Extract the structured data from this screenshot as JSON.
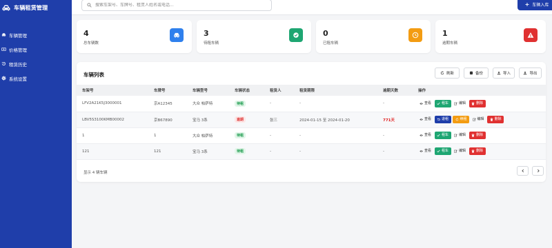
{
  "app": {
    "title": "车辆租赁管理"
  },
  "sidebar": {
    "items": [
      {
        "label": "车辆管理",
        "icon": "car-icon"
      },
      {
        "label": "价格管理",
        "icon": "money-icon"
      },
      {
        "label": "租赁历史",
        "icon": "history-icon"
      },
      {
        "label": "系统设置",
        "icon": "gear-icon"
      }
    ]
  },
  "search": {
    "placeholder": "搜索车架号、车牌号、租赁人姓名或电话..."
  },
  "header": {
    "add_button": "车辆入库"
  },
  "stats": [
    {
      "value": "4",
      "label": "总车辆数",
      "icon": "car-icon",
      "color": "#2f80ed"
    },
    {
      "value": "3",
      "label": "待租车辆",
      "icon": "check-circle-icon",
      "color": "#1ea672"
    },
    {
      "value": "0",
      "label": "已租车辆",
      "icon": "clock-icon",
      "color": "#f39c12"
    },
    {
      "value": "1",
      "label": "逾期车辆",
      "icon": "warning-icon",
      "color": "#e03131"
    }
  ],
  "table": {
    "title": "车辆列表",
    "toolbar": {
      "refresh": "刷新",
      "backup": "备份",
      "import": "导入",
      "export": "导出"
    },
    "columns": [
      "车架号",
      "车牌号",
      "车辆型号",
      "车辆状态",
      "租赁人",
      "租赁期限",
      "逾期天数",
      "操作"
    ],
    "rows": [
      {
        "vin": "LFV2A21K5J3000001",
        "plate": "京A12345",
        "model": "大众 帕萨特",
        "status": "待租",
        "renter": "-",
        "period": "-",
        "overdue": "-",
        "actions": {
          "view": "查看",
          "primary": "租车",
          "edit": "编辑",
          "delete": "删除"
        }
      },
      {
        "vin": "LBV5S3100KMB00002",
        "plate": "京B67890",
        "model": "宝马 3系",
        "status": "逾期",
        "renter": "张三",
        "period": "2024-01-15 至 2024-01-20",
        "overdue": "771天",
        "actions": {
          "view": "查看",
          "return": "退租",
          "renew": "续租",
          "edit": "编辑",
          "delete": "删除"
        }
      },
      {
        "vin": "1",
        "plate": "1",
        "model": "大众 帕萨特",
        "status": "待租",
        "renter": "-",
        "period": "-",
        "overdue": "-",
        "actions": {
          "view": "查看",
          "primary": "租车",
          "edit": "编辑",
          "delete": "删除"
        }
      },
      {
        "vin": "121",
        "plate": "121",
        "model": "宝马 3系",
        "status": "待租",
        "renter": "-",
        "period": "-",
        "overdue": "-",
        "actions": {
          "view": "查看",
          "primary": "租车",
          "edit": "编辑",
          "delete": "删除"
        }
      }
    ],
    "footer": "显示 4 辆车辆"
  },
  "colors": {
    "brand": "#1f3eaa",
    "green": "#1ea672",
    "orange": "#f39c12",
    "red": "#e03131",
    "blue": "#2f80ed"
  }
}
